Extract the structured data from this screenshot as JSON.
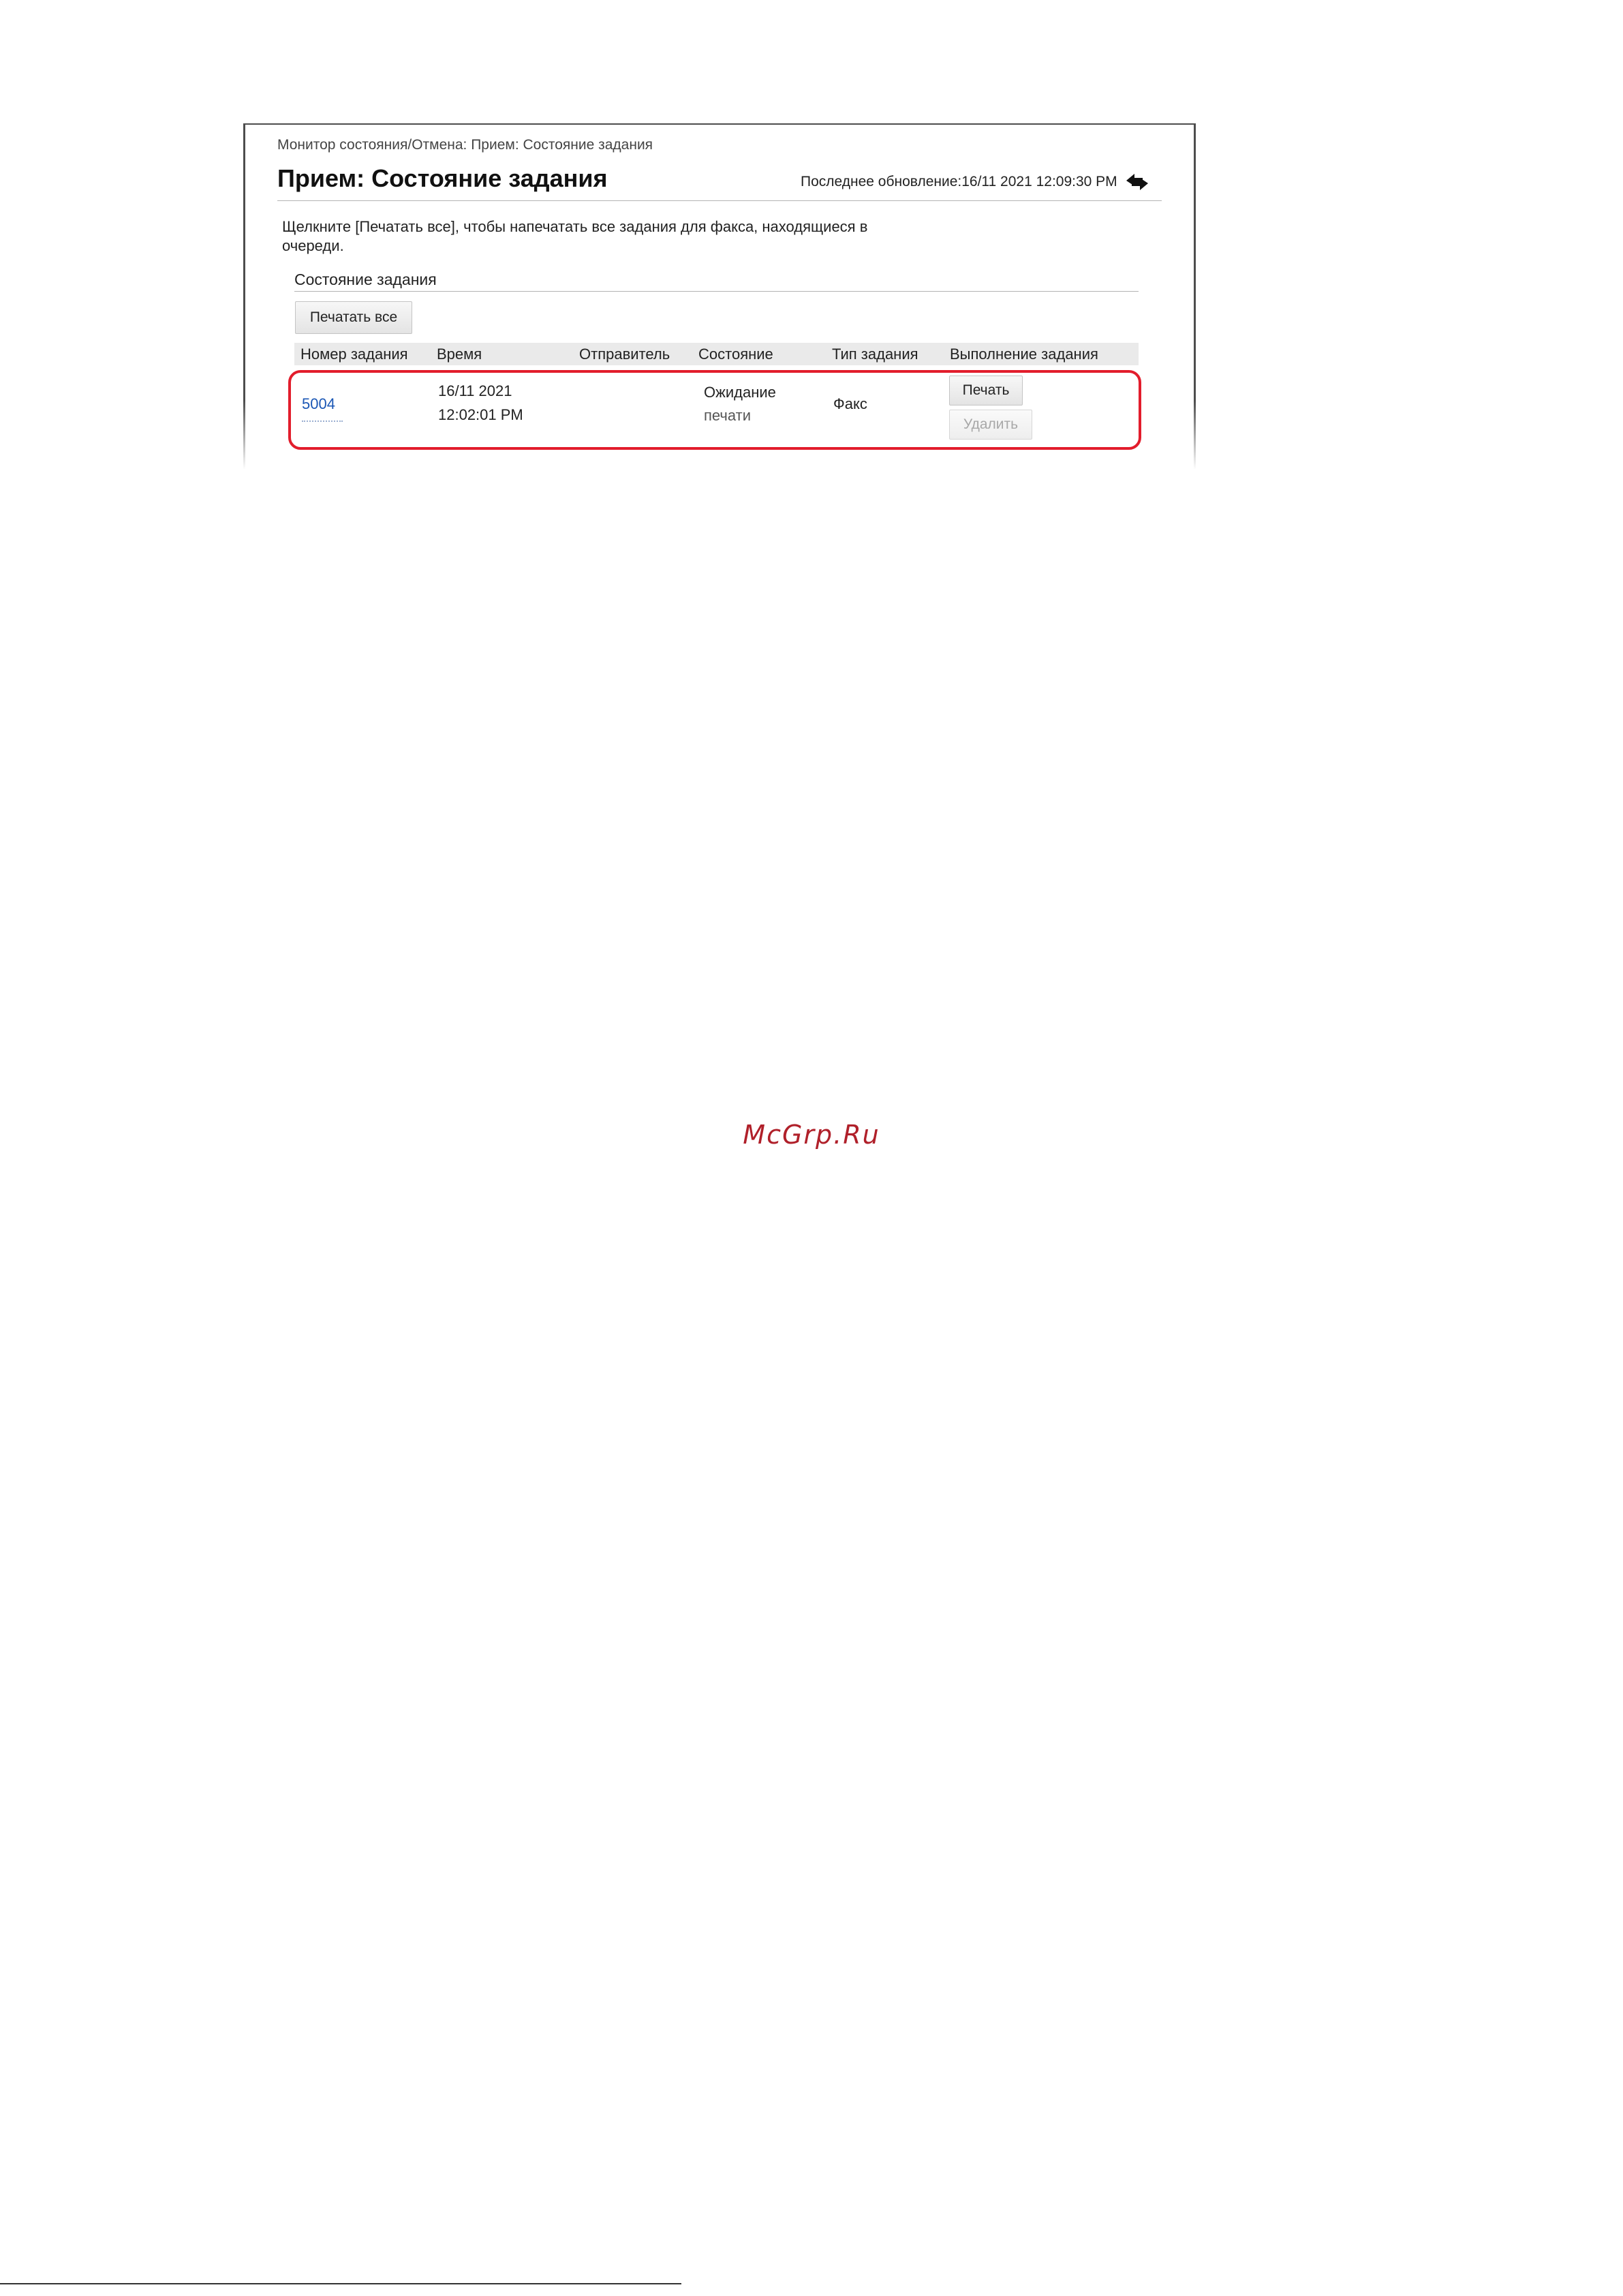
{
  "breadcrumb": "Монитор состояния/Отмена: Прием: Состояние задания",
  "page_title": "Прием: Состояние задания",
  "last_update": "Последнее обновление:16/11 2021 12:09:30 PM",
  "refresh_icon": "refresh-arrows-icon",
  "instruction": "Щелкните [Печатать все], чтобы напечатать все задания для факса, находящиеся в очереди.",
  "job_status_section": {
    "title": "Состояние задания",
    "print_all_label": "Печатать все"
  },
  "table": {
    "columns": [
      "Номер задания",
      "Время",
      "Отправитель",
      "Состояние",
      "Тип задания",
      "Выполнение задания"
    ],
    "rows": [
      {
        "job_number": "5004",
        "time_date": "16/11 2021",
        "time_clock": "12:02:01 PM",
        "sender": "",
        "status_line1": "Ожидание",
        "status_line2": "печати",
        "job_type": "Факс",
        "print_label": "Печать",
        "delete_label": "Удалить"
      }
    ]
  },
  "colors": {
    "highlight": "#e21d2c",
    "link": "#1b57b5",
    "watermark": "#b0202a"
  },
  "watermark": "McGrp.Ru"
}
